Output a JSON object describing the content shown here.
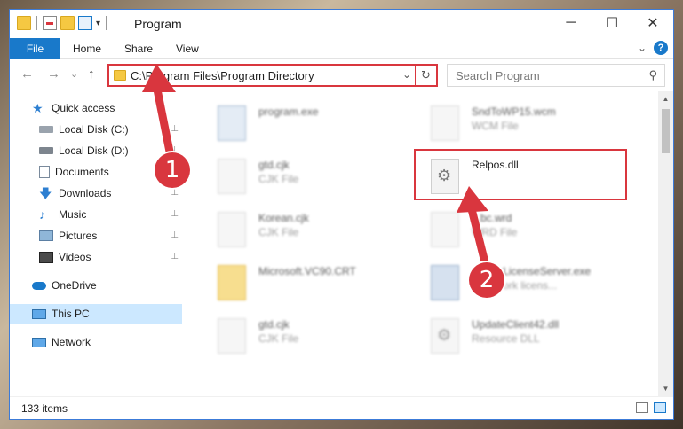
{
  "window": {
    "title": "Program"
  },
  "ribbon": {
    "tabs": [
      {
        "label": "File"
      },
      {
        "label": "Home"
      },
      {
        "label": "Share"
      },
      {
        "label": "View"
      }
    ],
    "help_glyph": "?",
    "collapse_glyph": "⌄"
  },
  "titlebar": {
    "qat_dropdown": "▾",
    "minimize": "─",
    "maximize": "☐",
    "close": "✕"
  },
  "nav": {
    "back": "←",
    "forward": "→",
    "recent": "⌄",
    "up": "↑",
    "address": "C:\\Program Files\\Program Directory",
    "address_dropdown": "⌄",
    "refresh": "↻",
    "search_placeholder": "Search Program",
    "search_icon": "⚲"
  },
  "sidebar": {
    "items": [
      {
        "label": "Quick access",
        "icon": "star-icon",
        "pinned": false
      },
      {
        "label": "Local Disk (C:)",
        "icon": "drive-icon",
        "pinned": true
      },
      {
        "label": "Local Disk (D:)",
        "icon": "drive-icon",
        "pinned": true
      },
      {
        "label": "Documents",
        "icon": "documents-icon",
        "pinned": true
      },
      {
        "label": "Downloads",
        "icon": "downloads-icon",
        "pinned": true
      },
      {
        "label": "Music",
        "icon": "music-icon",
        "pinned": true
      },
      {
        "label": "Pictures",
        "icon": "pictures-icon",
        "pinned": true
      },
      {
        "label": "Videos",
        "icon": "videos-icon",
        "pinned": true
      },
      {
        "label": "OneDrive",
        "icon": "onedrive-icon",
        "pinned": false
      },
      {
        "label": "This PC",
        "icon": "this-pc-icon",
        "pinned": false,
        "selected": true
      },
      {
        "label": "Network",
        "icon": "network-icon",
        "pinned": false
      }
    ],
    "pin_glyph": "📌"
  },
  "files": [
    {
      "name": "program.exe",
      "type": "",
      "icon": "exe-icon"
    },
    {
      "name": "SndToWP15.wcm",
      "type": "WCM File",
      "icon": "file-icon"
    },
    {
      "name": "gtd.cjk",
      "type": "CJK File",
      "icon": "file-icon"
    },
    {
      "name": "Relpos.dll",
      "type": "",
      "icon": "dll-icon"
    },
    {
      "name": "Korean.cjk",
      "type": "CJK File",
      "icon": "file-icon"
    },
    {
      "name": "...bc.wrd",
      "type": "WRD File",
      "icon": "file-icon"
    },
    {
      "name": "Microsoft.VC90.CRT",
      "type": "",
      "icon": "folder-icon"
    },
    {
      "name": "...workLicenseServer.exe",
      "type": "...network licens...",
      "icon": "exe-icon"
    },
    {
      "name": "gtd.cjk",
      "type": "CJK File",
      "icon": "file-icon"
    },
    {
      "name": "UpdateClient42.dll",
      "type": "Resource DLL",
      "icon": "dll-icon"
    }
  ],
  "status": {
    "item_count": "133 items"
  },
  "annotations": [
    {
      "number": "1"
    },
    {
      "number": "2"
    }
  ],
  "colors": {
    "accent": "#1979ca",
    "annotation": "#d9363e",
    "selected": "#cce8ff"
  }
}
